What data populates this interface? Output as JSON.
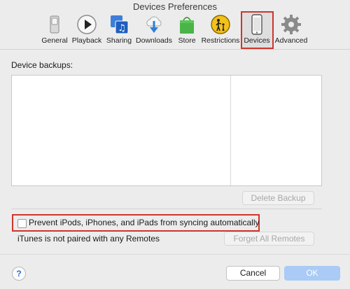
{
  "window": {
    "title": "Devices Preferences"
  },
  "toolbar": {
    "items": [
      {
        "label": "General",
        "icon": "general-switch-icon"
      },
      {
        "label": "Playback",
        "icon": "play-icon"
      },
      {
        "label": "Sharing",
        "icon": "sharing-music-icon"
      },
      {
        "label": "Downloads",
        "icon": "cloud-download-icon"
      },
      {
        "label": "Store",
        "icon": "shopping-bag-icon"
      },
      {
        "label": "Restrictions",
        "icon": "parental-restrictions-icon"
      },
      {
        "label": "Devices",
        "icon": "iphone-icon",
        "selected": true
      },
      {
        "label": "Advanced",
        "icon": "gear-icon"
      }
    ]
  },
  "backups": {
    "label": "Device backups:",
    "delete_button": "Delete Backup"
  },
  "options": {
    "prevent_sync_label": "Prevent iPods, iPhones, and iPads from syncing automatically",
    "prevent_sync_checked": false,
    "remotes_status": "iTunes is not paired with any Remotes",
    "forget_remotes_button": "Forget All Remotes"
  },
  "footer": {
    "help": "?",
    "cancel": "Cancel",
    "ok": "OK"
  },
  "colors": {
    "highlight": "#d0342c",
    "ok_button": "#a9cbf5",
    "background": "#ececec"
  }
}
